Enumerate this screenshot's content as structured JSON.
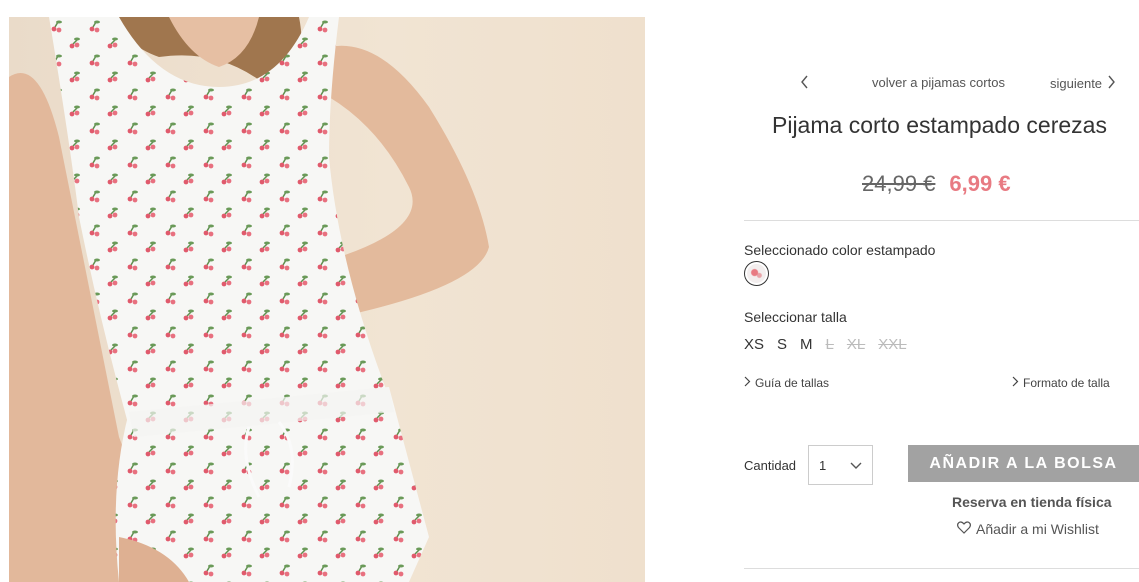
{
  "nav": {
    "back_label": "volver a pijamas cortos",
    "next_label": "siguiente"
  },
  "product": {
    "title": "Pijama corto estampado cerezas",
    "old_price": "24,99 €",
    "new_price": "6,99 €"
  },
  "color": {
    "label": "Seleccionado color estampado"
  },
  "size": {
    "label": "Seleccionar talla",
    "options": [
      {
        "label": "XS",
        "available": true
      },
      {
        "label": "S",
        "available": true
      },
      {
        "label": "M",
        "available": true
      },
      {
        "label": "L",
        "available": false
      },
      {
        "label": "XL",
        "available": false
      },
      {
        "label": "XXL",
        "available": false
      }
    ]
  },
  "links": {
    "size_guide": "Guía de tallas",
    "size_format": "Formato de talla"
  },
  "quantity": {
    "label": "Cantidad",
    "value": "1"
  },
  "actions": {
    "add_to_bag": "AÑADIR A LA BOLSA",
    "reserve": "Reserva en tienda física",
    "wishlist": "Añadir a mi Wishlist"
  },
  "colors": {
    "sale_price": "#e87a82",
    "button_bg": "#a2a2a2"
  }
}
